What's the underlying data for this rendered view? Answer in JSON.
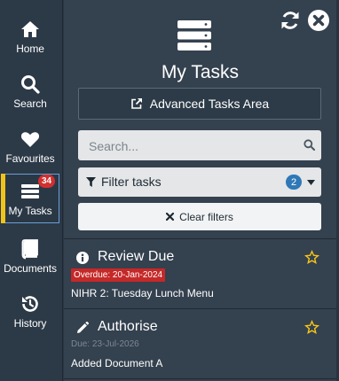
{
  "sidebar": {
    "items": [
      {
        "label": "Home",
        "icon": "home-icon"
      },
      {
        "label": "Search",
        "icon": "search-icon"
      },
      {
        "label": "Favourites",
        "icon": "heart-icon"
      },
      {
        "label": "My Tasks",
        "icon": "tasks-icon",
        "badge": "34",
        "active": true
      },
      {
        "label": "Documents",
        "icon": "book-icon"
      },
      {
        "label": "History",
        "icon": "history-icon"
      }
    ]
  },
  "panel": {
    "title": "My Tasks",
    "refresh_icon": "refresh-icon",
    "close_icon": "close-icon",
    "advanced_button": "Advanced Tasks Area",
    "search_placeholder": "Search...",
    "filter": {
      "label": "Filter tasks",
      "count": "2"
    },
    "clear_button": "Clear filters"
  },
  "tasks": [
    {
      "title": "Review Due",
      "icon": "info-icon",
      "status": "Overdue: 20-Jan-2024",
      "status_type": "overdue",
      "description": "NIHR 2: Tuesday Lunch Menu"
    },
    {
      "title": "Authorise",
      "icon": "pencil-icon",
      "status": "Due: 23-Jul-2026",
      "status_type": "due",
      "description": "Added Document A"
    }
  ],
  "colors": {
    "sidebar_bg": "#2c3947",
    "panel_bg": "#34414f",
    "active_marker": "#f0c419",
    "badge_red": "#d32f2f",
    "filter_count_blue": "#2f78b7",
    "star_yellow": "#f5c518"
  }
}
